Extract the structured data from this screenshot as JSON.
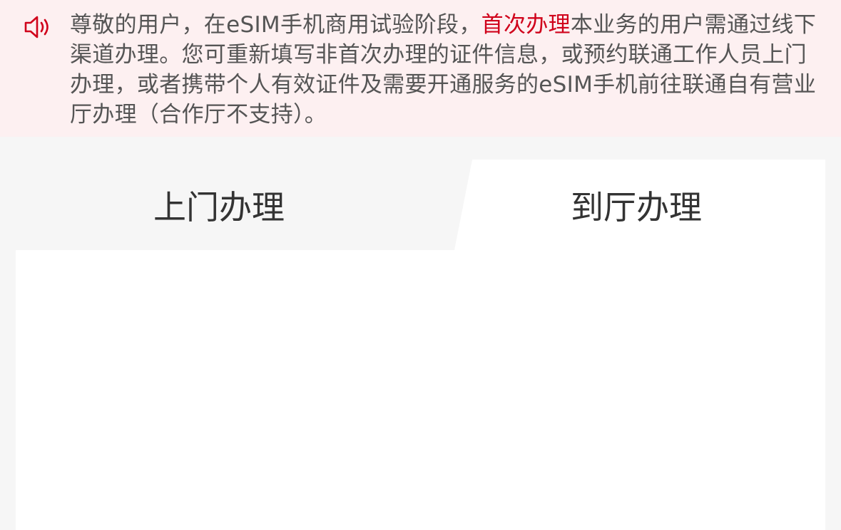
{
  "notice": {
    "icon": "speaker-icon",
    "text_before": "尊敬的用户，在eSIM手机商用试验阶段，",
    "highlight": "首次办理",
    "text_after": "本业务的用户需通过线下渠道办理。您可重新填写非首次办理的证件信息，或预约联通工作人员上门办理，或者携带个人有效证件及需要开通服务的eSIM手机前往联通自有营业厅办理（合作厅不支持）。",
    "highlight_color": "#d0021b",
    "background_color": "#fdf0f1"
  },
  "tabs": {
    "items": [
      {
        "label": "上门办理",
        "selected": false
      },
      {
        "label": "到厅办理",
        "selected": true
      }
    ]
  }
}
